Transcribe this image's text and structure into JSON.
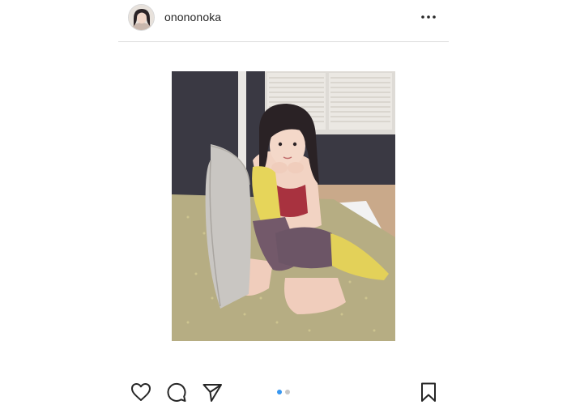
{
  "post": {
    "username": "onononoka",
    "carousel": {
      "total_slides": 2,
      "current_slide": 1,
      "active_color": "#3897f0",
      "inactive_color": "#c7c7c7"
    }
  },
  "icons": {
    "more": "more-options-icon",
    "like": "heart-icon",
    "comment": "comment-bubble-icon",
    "share": "paper-plane-icon",
    "save": "bookmark-icon"
  },
  "colors": {
    "text": "#262626",
    "divider": "#dbdbdb",
    "background": "#ffffff"
  }
}
